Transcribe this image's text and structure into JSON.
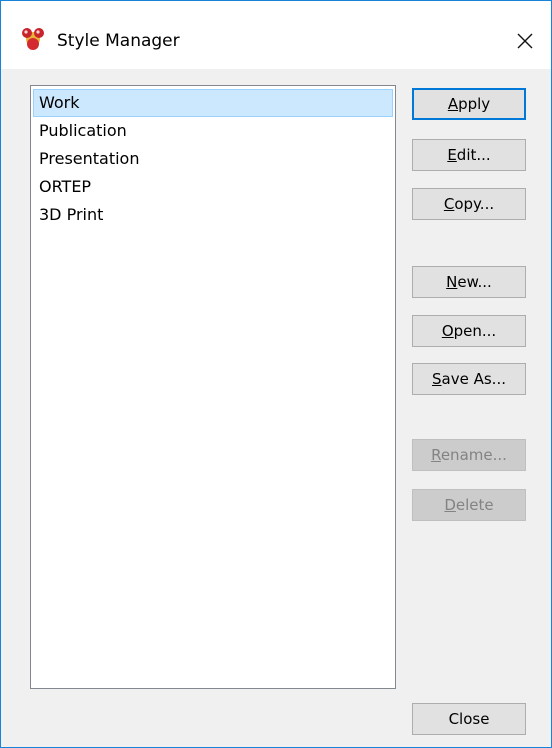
{
  "window": {
    "title": "Style Manager",
    "app_icon": "molecule-icon",
    "close_icon": "close-icon"
  },
  "styles_list": {
    "items": [
      {
        "label": "Work",
        "selected": true
      },
      {
        "label": "Publication",
        "selected": false
      },
      {
        "label": "Presentation",
        "selected": false
      },
      {
        "label": "ORTEP",
        "selected": false
      },
      {
        "label": "3D Print",
        "selected": false
      }
    ]
  },
  "buttons": {
    "apply": {
      "mnemonic": "A",
      "rest": "pply",
      "enabled": true,
      "default": true
    },
    "edit": {
      "mnemonic": "E",
      "rest": "dit...",
      "enabled": true
    },
    "copy": {
      "mnemonic": "C",
      "rest": "opy...",
      "enabled": true
    },
    "new": {
      "mnemonic": "N",
      "rest": "ew...",
      "enabled": true
    },
    "open": {
      "mnemonic": "O",
      "rest": "pen...",
      "enabled": true
    },
    "save_as": {
      "mnemonic": "S",
      "rest": "ave As...",
      "enabled": true
    },
    "rename": {
      "mnemonic": "R",
      "rest": "ename...",
      "enabled": false
    },
    "delete": {
      "mnemonic": "D",
      "rest": "elete",
      "enabled": false
    },
    "close": {
      "label": "Close",
      "enabled": true
    }
  },
  "colors": {
    "window_border": "#1883d7",
    "selection_bg": "#cce8ff",
    "default_button_border": "#0078d7",
    "disabled_text": "#838383"
  }
}
